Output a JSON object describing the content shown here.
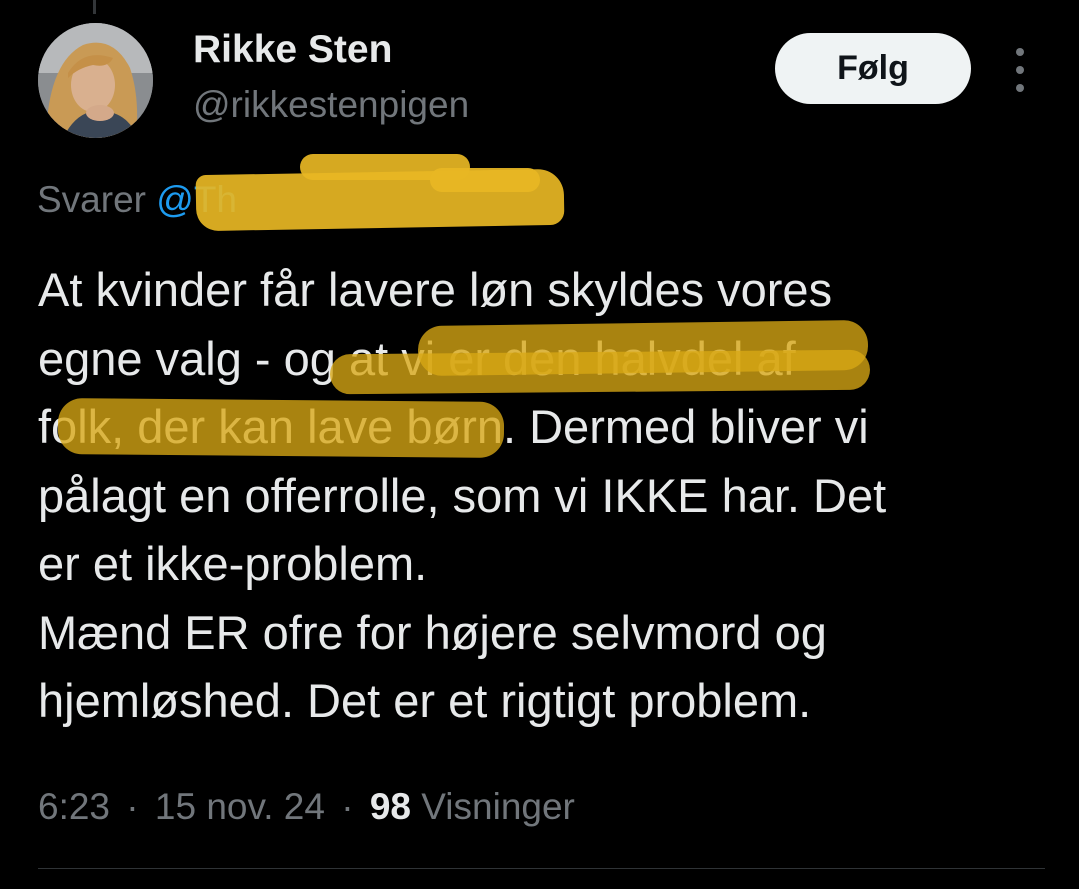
{
  "tweet": {
    "author": {
      "display_name": "Rikke Sten",
      "handle": "@rikkestenpigen"
    },
    "follow_label": "Følg",
    "more_icon": "more-vertical-icon",
    "reply": {
      "prefix": "Svarer",
      "mention": "@Th"
    },
    "text_lines": [
      "At kvinder får lavere løn skyldes vores",
      "egne valg - og at vi er den halvdel af",
      "folk, der kan lave børn. Dermed bliver vi",
      "pålagt en offerrolle, som vi IKKE har. Det",
      "er et ikke-problem.",
      "Mænd ER ofre for højere selvmord og",
      "hjemløshed. Det er et rigtigt problem."
    ],
    "meta": {
      "time": "6:23",
      "separator": "·",
      "date": "15 nov. 24",
      "views_count": "98",
      "views_label": "Visninger"
    }
  },
  "colors": {
    "background": "#000000",
    "text_primary": "#e7e9ea",
    "text_secondary": "#71767b",
    "link": "#1d9bf0",
    "highlighter": "#e8b724",
    "follow_button_bg": "#eff3f4",
    "follow_button_text": "#0f1419"
  }
}
